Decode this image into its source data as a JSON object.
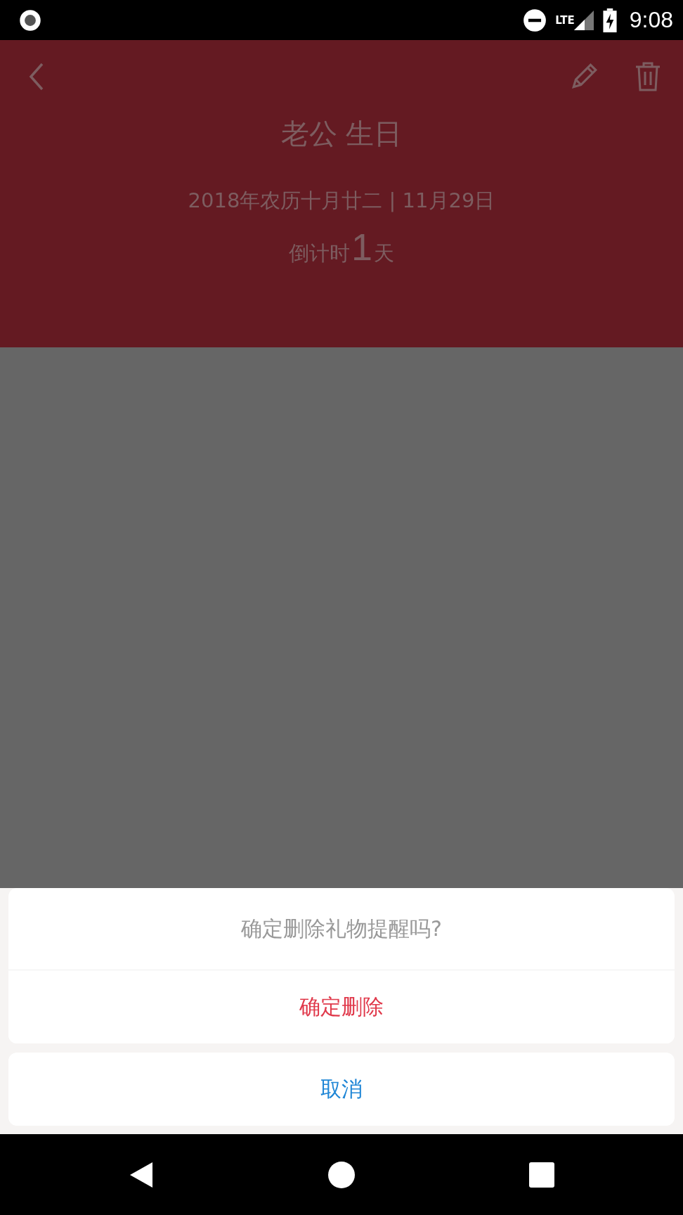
{
  "status_bar": {
    "network": "LTE",
    "time": "9:08"
  },
  "header": {
    "title": "老公 生日",
    "date": "2018年农历十月廿二 | 11月29日",
    "countdown": {
      "prefix": "倒计时",
      "number": "1",
      "suffix": "天"
    }
  },
  "action_sheet": {
    "title": "确定删除礼物提醒吗?",
    "actions": [
      {
        "label": "确定删除",
        "kind": "destructive"
      }
    ],
    "cancel": "取消"
  }
}
